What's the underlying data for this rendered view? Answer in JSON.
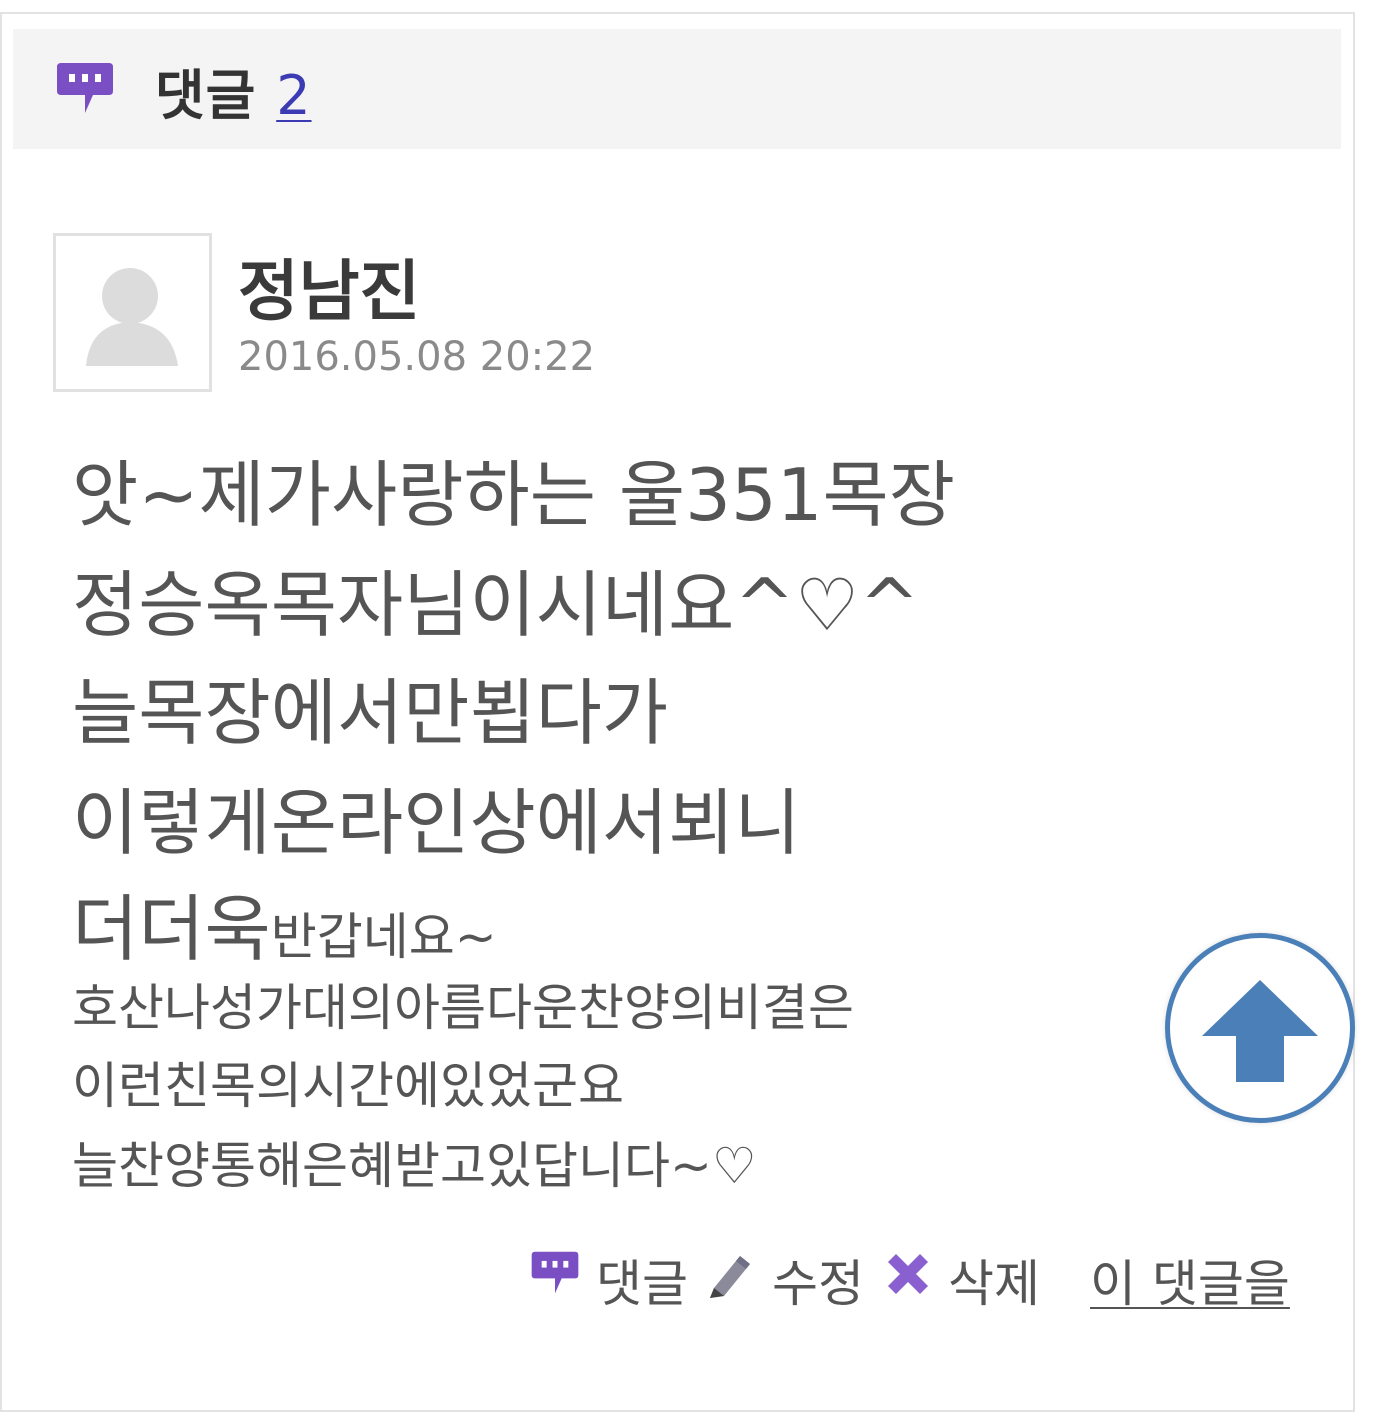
{
  "header": {
    "title": "댓글",
    "count": "2",
    "icon": "speech-bubble-icon",
    "icon_color": "#7a4fc4"
  },
  "comment": {
    "author": "정남진",
    "datetime": "2016.05.08 20:22",
    "lines": [
      "앗~제가사랑하는 울351목장",
      "정승옥목자님이시네요^♡^",
      "늘목장에서만뵙다가",
      "이렇게온라인상에서뵈니",
      "더더욱",
      "반갑네요~",
      "호산나성가대의아름다운찬양의비결은",
      "이런친목의시간에있었군요",
      "늘찬양통해은혜받고있답니다~♡"
    ]
  },
  "actions": {
    "reply_label": "댓글",
    "edit_label": "수정",
    "delete_label": "삭제",
    "share_label": "이 댓글을"
  },
  "scroll_top": {
    "icon": "arrow-up-icon",
    "color": "#4a7fb8"
  }
}
